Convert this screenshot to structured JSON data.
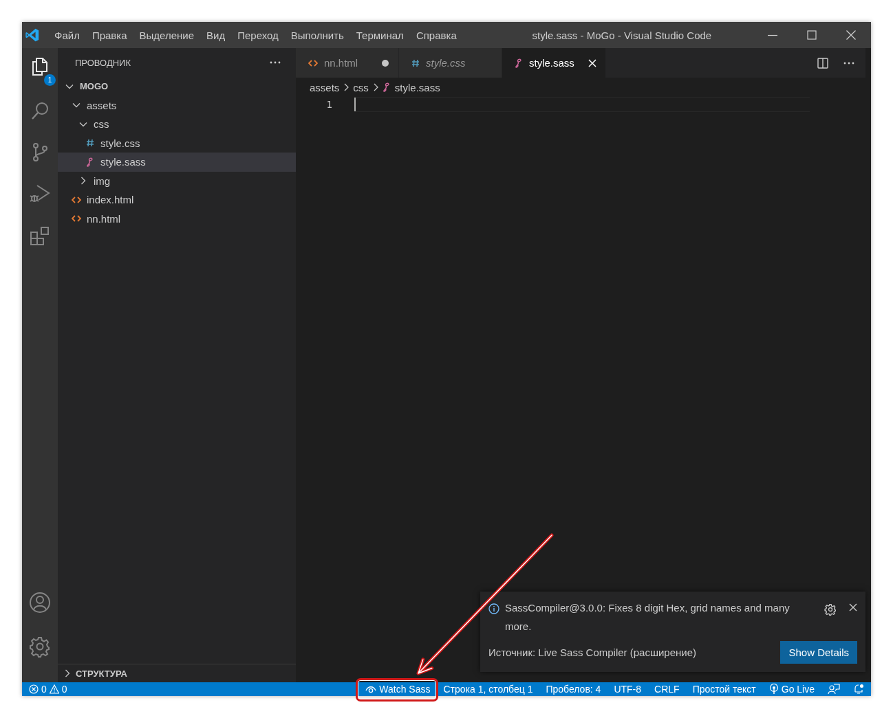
{
  "window": {
    "title": "style.sass - MoGo - Visual Studio Code"
  },
  "menu": [
    "Файл",
    "Правка",
    "Выделение",
    "Вид",
    "Переход",
    "Выполнить",
    "Терминал",
    "Справка"
  ],
  "activity_bar": {
    "explorer_badge": "1"
  },
  "sidebar": {
    "title": "ПРОВОДНИК",
    "tree": [
      {
        "label": "MOGO",
        "kind": "root",
        "expanded": true,
        "children": [
          {
            "label": "assets",
            "kind": "folder",
            "expanded": true,
            "children": [
              {
                "label": "css",
                "kind": "folder",
                "expanded": true,
                "children": [
                  {
                    "label": "style.css",
                    "kind": "css",
                    "selected": false
                  },
                  {
                    "label": "style.sass",
                    "kind": "sass",
                    "selected": true
                  }
                ]
              },
              {
                "label": "img",
                "kind": "folder",
                "expanded": false
              }
            ]
          },
          {
            "label": "index.html",
            "kind": "html",
            "selected": false
          },
          {
            "label": "nn.html",
            "kind": "html",
            "selected": false
          }
        ]
      }
    ],
    "outline": {
      "label": "СТРУКТУРА",
      "expanded": false
    }
  },
  "tabs": [
    {
      "label": "nn.html",
      "kind": "html",
      "selected": false,
      "modified": true,
      "preview": false
    },
    {
      "label": "style.css",
      "kind": "css",
      "selected": false,
      "modified": false,
      "preview": true
    },
    {
      "label": "style.sass",
      "kind": "sass",
      "selected": true,
      "modified": false,
      "preview": false
    }
  ],
  "breadcrumbs": [
    {
      "label": "assets",
      "kind": "folder"
    },
    {
      "label": "css",
      "kind": "folder"
    },
    {
      "label": "style.sass",
      "kind": "sass"
    }
  ],
  "editor": {
    "line_numbers": [
      "1"
    ]
  },
  "notification": {
    "message": "SassCompiler@3.0.0: Fixes 8 digit Hex, grid names and many more.",
    "source": "Источник: Live Sass Compiler (расширение)",
    "button": "Show Details"
  },
  "status_bar": {
    "errors": "0",
    "warnings": "0",
    "items": [
      {
        "label": "Watch Sass",
        "kind": "watch",
        "highlighted": true
      },
      {
        "label": "Строка 1, столбец 1",
        "kind": "text",
        "highlighted": false
      },
      {
        "label": "Пробелов: 4",
        "kind": "text",
        "highlighted": false
      },
      {
        "label": "UTF-8",
        "kind": "text",
        "highlighted": false
      },
      {
        "label": "CRLF",
        "kind": "text",
        "highlighted": false
      },
      {
        "label": "Простой текст",
        "kind": "text",
        "highlighted": false
      },
      {
        "label": "Go Live",
        "kind": "live",
        "highlighted": false
      }
    ]
  }
}
